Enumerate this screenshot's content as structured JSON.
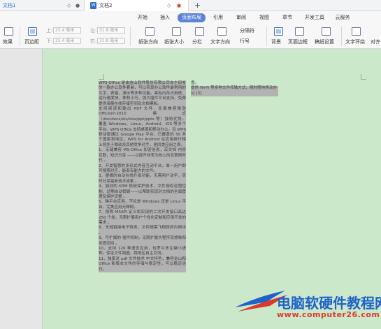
{
  "tabs": [
    {
      "label": "文档1"
    },
    {
      "label": "文档2",
      "icon": "W"
    }
  ],
  "tab_controls": {
    "pin": "◇",
    "close": "●",
    "new_tab": "+"
  },
  "menu": [
    "开始",
    "插入",
    "页面布局",
    "引用",
    "审阅",
    "视图",
    "章节",
    "开发工具",
    "云服务"
  ],
  "active_menu": "页面布局",
  "ribbon": {
    "effects": "效果",
    "margins": "页边距",
    "top_label": "上:",
    "top_value": "25.4 毫米",
    "bottom_label": "下:",
    "bottom_value": "25.4 毫米",
    "left_label": "左:",
    "left_value": "31.8 毫米",
    "right_label": "右:",
    "right_value": "31.8 毫米",
    "orientation": "纸张方向",
    "size": "纸张大小",
    "columns": "分栏",
    "direction": "文字方向",
    "breaks": "分隔符",
    "line_numbers": "行号",
    "background": "背景",
    "page_border": "页面边框",
    "manuscript": "稿纸设置",
    "text_wrap": "文字环绕",
    "align": "对齐"
  },
  "document": {
    "left_column": [
      "WPS Office 是由金山软件股份有限公司自主研发的一款办公软件套装，可以实现办公软件最常用的文字、表格、演示等多种功能。具有内存占用低、运行速度快、体积小巧、强大插件平台支持、免费提供海量在线存储空间及文档模板。",
      "支持阅读和输出 PDF 文件、全面兼容微软 Office97-2010 格式（doc/docx/xls/xlsx/ppt/pptx 等）独特优势。覆盖 Windows、Linux、Android、iOS 等多个平台。WPS Office 支持桌面和移动办公。且 WPS 移动版通过 Google Play 平台，已覆盖的 50 多个国家和地区，WPS for Android 在应用排行榜上领先于微软及其他竞争对手，居同类应用之首。",
      "1、无缝兼容 MS-Office 加密信息，宏文档 内容互联，知识分享 ——以提升效率为核心的互联网时代 。",
      "2、开发智慧的多形式内容互动平台，单一用户即可按照对应，能者有能力的文件。",
      "3、便捷的自动在线升级功能，无需用户动手，实时分享最新技术成果 。",
      "4、独创的 KRM 帆软保护技术，文件授权远程控制，过期自动销毁——以帮助实现对文档的全面管理及保护设置 。",
      "5、跨平台应用，不论是 Windows 还是 Linux 平台，完美应用无障碍。",
      "7、按照 MSAPI 定义和实现的二次开发接口高达 250 个类，无限扩展用户个性化定制和应用开发的需求 。",
      "8、无缝链接电子政务，文件随需飞翔政府内网中 。",
      "9、可扩展的 插件机制，无限扩展大程序员想象和创造空间 。",
      "10、支持 126 种语言应用，包罗众多生僻小语种，保证文件跨国、跨地区自主交流。",
      "11、独家对 pdf 文件技术 中文特色，兼容金山和 Office 新版本文件的存储与稳定性，可以稳定运行。"
    ],
    "right_column": [
      {
        "text": "盘。",
        "highlighted": false
      },
      {
        "text": "提供 Wi-Fi 等多种文件传输方式，随时随地移动办公 [3]",
        "highlighted": true
      }
    ]
  },
  "watermark": {
    "title": "电脑软硬件教程网",
    "url": "www.computer26.com"
  },
  "colors": {
    "accent": "#5b84d6",
    "page_green": "#cbe8cb",
    "highlight": "#b2b2b2",
    "watermark_blue": "#1f62c9",
    "watermark_red": "#d83a2c"
  }
}
